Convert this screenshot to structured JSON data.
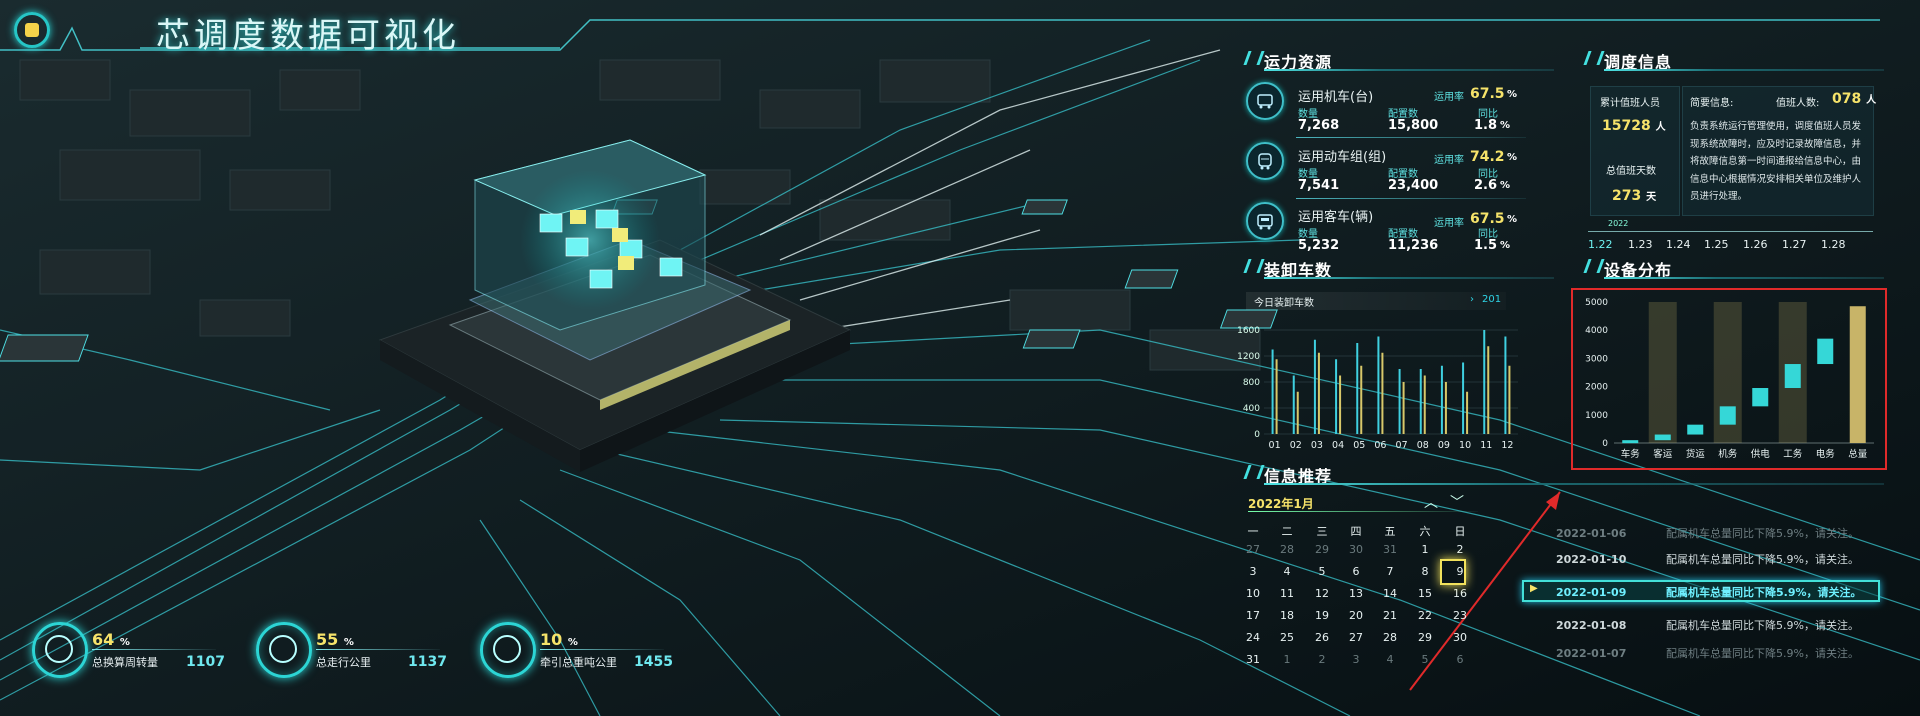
{
  "header": {
    "title": "芯调度数据可视化"
  },
  "transport": {
    "title": "运力资源",
    "items": [
      {
        "name": "运用机车(台)",
        "rate_label": "运用率",
        "rate": "67.5",
        "pct_sign": "%",
        "qty_label": "数量",
        "qty": "7,268",
        "cfg_label": "配置数",
        "cfg": "15,800",
        "yoy_label": "同比",
        "yoy": "1.8",
        "yoy_sign": "%"
      },
      {
        "name": "运用动车组(组)",
        "rate_label": "运用率",
        "rate": "74.2",
        "pct_sign": "%",
        "qty_label": "数量",
        "qty": "7,541",
        "cfg_label": "配置数",
        "cfg": "23,400",
        "yoy_label": "同比",
        "yoy": "2.6",
        "yoy_sign": "%"
      },
      {
        "name": "运用客车(辆)",
        "rate_label": "运用率",
        "rate": "67.5",
        "pct_sign": "%",
        "qty_label": "数量",
        "qty": "5,232",
        "cfg_label": "配置数",
        "cfg": "11,236",
        "yoy_label": "同比",
        "yoy": "1.5",
        "yoy_sign": "%"
      }
    ]
  },
  "dispatch": {
    "title": "调度信息",
    "cum_label": "累计值班人员",
    "cum_value": "15728",
    "cum_unit": "人",
    "days_label": "总值班天数",
    "days_value": "273",
    "days_unit": "天",
    "brief_label": "简要信息:",
    "duty_label": "值班人数:",
    "duty_value": "078",
    "duty_unit": "人",
    "brief_text": "负责系统运行管理使用，调度值班人员发现系统故障时，应及时记录故障信息，并将故障信息第一时间通报给信息中心，由信息中心根据情况安排相关单位及维护人员进行处理。",
    "timeline_year": "2022",
    "timeline": [
      "1.22",
      "1.23",
      "1.24",
      "1.25",
      "1.26",
      "1.27",
      "1.28"
    ]
  },
  "loading": {
    "title": "装卸车数",
    "today_label": "今日装卸车数",
    "today_value": "201",
    "yticks": [
      "1600",
      "1200",
      "800",
      "400",
      "0"
    ],
    "months": [
      "01",
      "02",
      "03",
      "04",
      "05",
      "06",
      "07",
      "08",
      "09",
      "10",
      "11",
      "12"
    ]
  },
  "chart_data": [
    {
      "type": "bar",
      "title": "装卸车数",
      "categories": [
        "01",
        "02",
        "03",
        "04",
        "05",
        "06",
        "07",
        "08",
        "09",
        "10",
        "11",
        "12"
      ],
      "series": [
        {
          "values": [
            1300,
            900,
            1450,
            1150,
            1400,
            1500,
            1000,
            1000,
            1050,
            1100,
            1600,
            1500
          ]
        },
        {
          "values": [
            1150,
            650,
            1250,
            900,
            1050,
            1250,
            800,
            900,
            800,
            650,
            1350,
            1050
          ]
        }
      ],
      "ylim": [
        0,
        1600
      ],
      "colors": [
        "#3fd0e0",
        "#d8c86a"
      ]
    },
    {
      "type": "bar",
      "title": "设备分布",
      "categories": [
        "车务",
        "客运",
        "货运",
        "机务",
        "供电",
        "工务",
        "电务",
        "总量"
      ],
      "values": [
        100,
        300,
        650,
        1300,
        1950,
        2800,
        3700,
        4850
      ],
      "ylim": [
        0,
        5000
      ],
      "yticks": [
        "5000",
        "4000",
        "3000",
        "2000",
        "1000",
        "0"
      ],
      "colors": [
        "#35d7d7",
        "#c8b468"
      ]
    }
  ],
  "equipment": {
    "title": "设备分布"
  },
  "info": {
    "title": "信息推荐",
    "month": "2022年1月",
    "weekdays": [
      "一",
      "二",
      "三",
      "四",
      "五",
      "六",
      "日"
    ],
    "days": [
      [
        "27",
        "28",
        "29",
        "30",
        "31",
        "1",
        "2"
      ],
      [
        "3",
        "4",
        "5",
        "6",
        "7",
        "8",
        "9"
      ],
      [
        "10",
        "11",
        "12",
        "13",
        "14",
        "15",
        "16"
      ],
      [
        "17",
        "18",
        "19",
        "20",
        "21",
        "22",
        "23"
      ],
      [
        "24",
        "25",
        "26",
        "27",
        "28",
        "29",
        "30"
      ],
      [
        "31",
        "1",
        "2",
        "3",
        "4",
        "5",
        "6"
      ]
    ],
    "messages": [
      {
        "date": "2022-01-06",
        "text": "配属机车总量同比下降5.9%，请关注。"
      },
      {
        "date": "2022-01-10",
        "text": "配属机车总量同比下降5.9%，请关注。"
      },
      {
        "date": "2022-01-09",
        "text": "配属机车总量同比下降5.9%，请关注。"
      },
      {
        "date": "2022-01-08",
        "text": "配属机车总量同比下降5.9%，请关注。"
      },
      {
        "date": "2022-01-07",
        "text": "配属机车总量同比下降5.9%，请关注。"
      }
    ]
  },
  "kpis": [
    {
      "pct": "64",
      "sign": "%",
      "label": "总换算周转量",
      "value": "1107"
    },
    {
      "pct": "55",
      "sign": "%",
      "label": "总走行公里",
      "value": "1137"
    },
    {
      "pct": "10",
      "sign": "%",
      "label": "牵引总重吨公里",
      "value": "1455"
    }
  ]
}
